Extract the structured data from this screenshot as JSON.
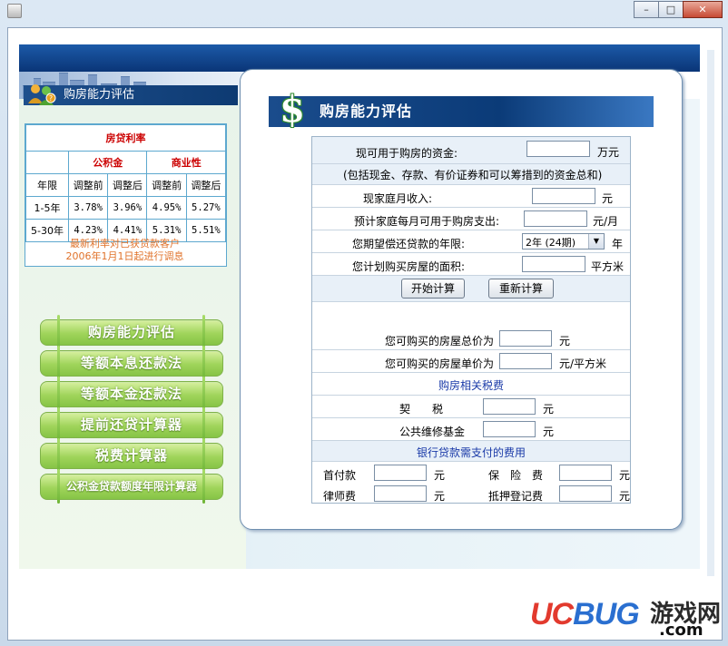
{
  "window": {
    "title": "",
    "controls": {
      "minimize": "–",
      "maximize": "□",
      "close": "✕"
    }
  },
  "sidebar": {
    "title": "购房能力评估",
    "rates": {
      "heading": "房贷利率",
      "group1": "公积金",
      "group2": "商业性",
      "col_year": "年限",
      "col_before": "调整前",
      "col_after": "调整后",
      "rows": [
        {
          "term": "1-5年",
          "gjj_before": "3.78%",
          "gjj_after": "3.96%",
          "sy_before": "4.95%",
          "sy_after": "5.27%"
        },
        {
          "term": "5-30年",
          "gjj_before": "4.23%",
          "gjj_after": "4.41%",
          "sy_before": "5.31%",
          "sy_after": "5.51%"
        }
      ],
      "note_line1": "最新利率对已获贷款客户",
      "note_line2": "2006年1月1日起进行调息"
    },
    "menu": [
      {
        "label": "购房能力评估"
      },
      {
        "label": "等额本息还款法"
      },
      {
        "label": "等额本金还款法"
      },
      {
        "label": "提前还贷计算器"
      },
      {
        "label": "税费计算器"
      },
      {
        "label": "公积金贷款额度年限计算器"
      }
    ]
  },
  "main": {
    "title": "购房能力评估",
    "dollar_glyph": "$",
    "funds_label": "现可用于购房的资金:",
    "funds_value": "",
    "funds_unit": "万元",
    "funds_hint": "(包括现金、存款、有价证券和可以筹措到的资金总和)",
    "income_label": "现家庭月收入:",
    "income_value": "",
    "income_unit": "元",
    "expense_label": "预计家庭每月可用于购房支出:",
    "expense_value": "",
    "expense_unit": "元/月",
    "years_label": "您期望偿还贷款的年限:",
    "years_value": "2年 (24期)",
    "years_unit": "年",
    "area_label": "您计划购买房屋的面积:",
    "area_value": "",
    "area_unit": "平方米",
    "calc_button": "开始计算",
    "reset_button": "重新计算",
    "total_price_label": "您可购买的房屋总价为",
    "total_price_value": "",
    "total_price_unit": "元",
    "unit_price_label": "您可购买的房屋单价为",
    "unit_price_value": "",
    "unit_price_unit": "元/平方米",
    "tax_section": "购房相关税费",
    "deed_tax_label": "契　　税",
    "deed_tax_value": "",
    "deed_tax_unit": "元",
    "maintenance_label": "公共维修基金",
    "maintenance_value": "",
    "maintenance_unit": "元",
    "bank_section": "银行贷款需支付的费用",
    "down_payment_label": "首付款",
    "down_payment_value": "",
    "down_payment_unit": "元",
    "insurance_label": "保　险　费",
    "insurance_value": "",
    "insurance_unit": "元",
    "lawyer_label": "律师费",
    "lawyer_value": "",
    "lawyer_unit": "元",
    "mortgage_label": "抵押登记费",
    "mortgage_value": "",
    "mortgage_unit": "元"
  },
  "watermark": {
    "uc": "UC",
    "bug": "BUG",
    "cn": "游戏网",
    "com": ".com"
  }
}
